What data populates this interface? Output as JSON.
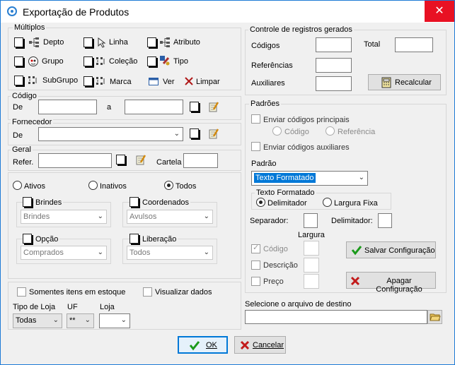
{
  "window": {
    "title": "Exportação de Produtos",
    "close_glyph": "✕"
  },
  "multiplos": {
    "label": "Múltiplos",
    "items": [
      {
        "label": "Depto",
        "icon": "tree-icon"
      },
      {
        "label": "Linha",
        "icon": "pointer-icon"
      },
      {
        "label": "Atributo",
        "icon": "tree-icon"
      },
      {
        "label": "Grupo",
        "icon": "face-icon"
      },
      {
        "label": "Coleção",
        "icon": "dots-icon"
      },
      {
        "label": "Tipo",
        "icon": "tool-icon"
      },
      {
        "label": "SubGrupo",
        "icon": "dots-icon"
      },
      {
        "label": "Marca",
        "icon": "dots-icon"
      },
      {
        "label": "Ver",
        "icon": "window-icon"
      },
      {
        "label": "Limpar",
        "icon": "x-icon"
      }
    ]
  },
  "codigo": {
    "label": "Código",
    "de": "De",
    "a": "a"
  },
  "fornecedor": {
    "label": "Fornecedor",
    "de": "De"
  },
  "geral": {
    "label": "Geral",
    "refer": "Refer.",
    "cartela": "Cartela"
  },
  "status": {
    "ativos": "Ativos",
    "inativos": "Inativos",
    "todos": "Todos",
    "selected": "todos"
  },
  "brindes": {
    "label": "Brindes",
    "value": "Brindes"
  },
  "coordenados": {
    "label": "Coordenados",
    "value": "Avulsos"
  },
  "opcao": {
    "label": "Opção",
    "value": "Comprados"
  },
  "liberacao": {
    "label": "Liberação",
    "value": "Todos"
  },
  "bottom": {
    "somente": "Somentes itens em estoque",
    "visualizar": "Visualizar dados",
    "tipo_loja_label": "Tipo de Loja",
    "tipo_loja_value": "Todas",
    "uf_label": "UF",
    "uf_value": "**",
    "loja_label": "Loja",
    "loja_value": ""
  },
  "controle": {
    "label": "Controle de registros gerados",
    "codigos": "Códigos",
    "total": "Total",
    "referencias": "Referências",
    "auxiliares": "Auxiliares",
    "recalcular": "Recalcular"
  },
  "padroes": {
    "label": "Padrões",
    "enviar_principais": "Enviar códigos principais",
    "codigo": "Código",
    "referencia": "Referência",
    "enviar_aux": "Enviar códigos auxiliares",
    "padrao_label": "Padrão",
    "padrao_value": "Texto Formatado"
  },
  "texto_formatado": {
    "label": "Texto Formatado",
    "delimitador": "Delimitador",
    "largura_fixa": "Largura Fixa",
    "selected": "delimitador"
  },
  "sep": {
    "separador": "Separador:",
    "delimitador": "Delimitador:",
    "largura": "Largura"
  },
  "campos": {
    "codigo": "Código",
    "descricao": "Descrição",
    "preco": "Preço"
  },
  "salvar": "Salvar Configuração",
  "apagar": "Apagar Configuração",
  "destino": {
    "label": "Selecione o arquivo de destino"
  },
  "ok": "OK",
  "cancelar": "Cancelar",
  "colors": {
    "accent": "#1e7bd6",
    "close": "#e81123",
    "green": "#1a9a1a",
    "red": "#c21a1a"
  }
}
